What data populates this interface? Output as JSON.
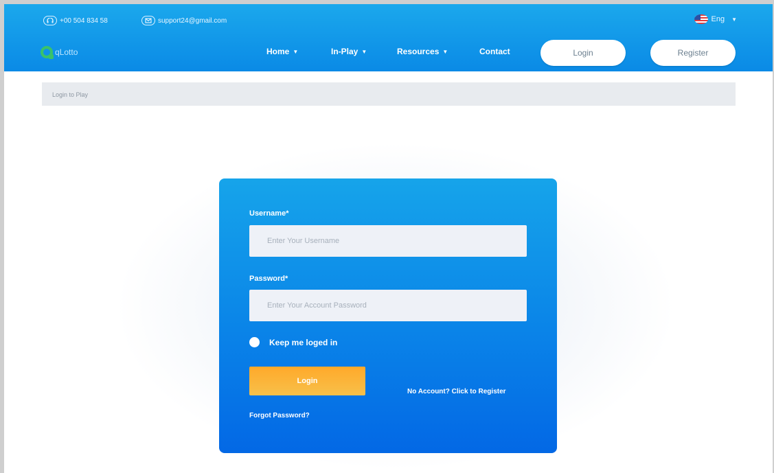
{
  "topbar": {
    "phone": "+00 504 834 58",
    "email": "support24@gmail.com",
    "language": "Eng"
  },
  "header": {
    "logo_text": "qLotto",
    "nav": [
      {
        "label": "Home"
      },
      {
        "label": "In-Play"
      },
      {
        "label": "Resources"
      },
      {
        "label": "Contact"
      }
    ],
    "login_label": "Login",
    "register_label": "Register"
  },
  "breadcrumb": "Login to Play",
  "form": {
    "username_label": "Username*",
    "username_placeholder": "Enter Your Username",
    "password_label": "Password*",
    "password_placeholder": "Enter Your Account Password",
    "remember_label": "Keep me loged in",
    "login_button": "Login",
    "register_link": "No Account? Click to Register",
    "forgot_link": "Forgot Password?"
  },
  "colors": {
    "header_gradient_start": "#1ba8ec",
    "header_gradient_end": "#0a8ae6",
    "card_gradient_start": "#16a4ea",
    "card_gradient_end": "#0368e5",
    "login_button_orange": "#ffa92a",
    "logo_green": "#3ac26a"
  }
}
